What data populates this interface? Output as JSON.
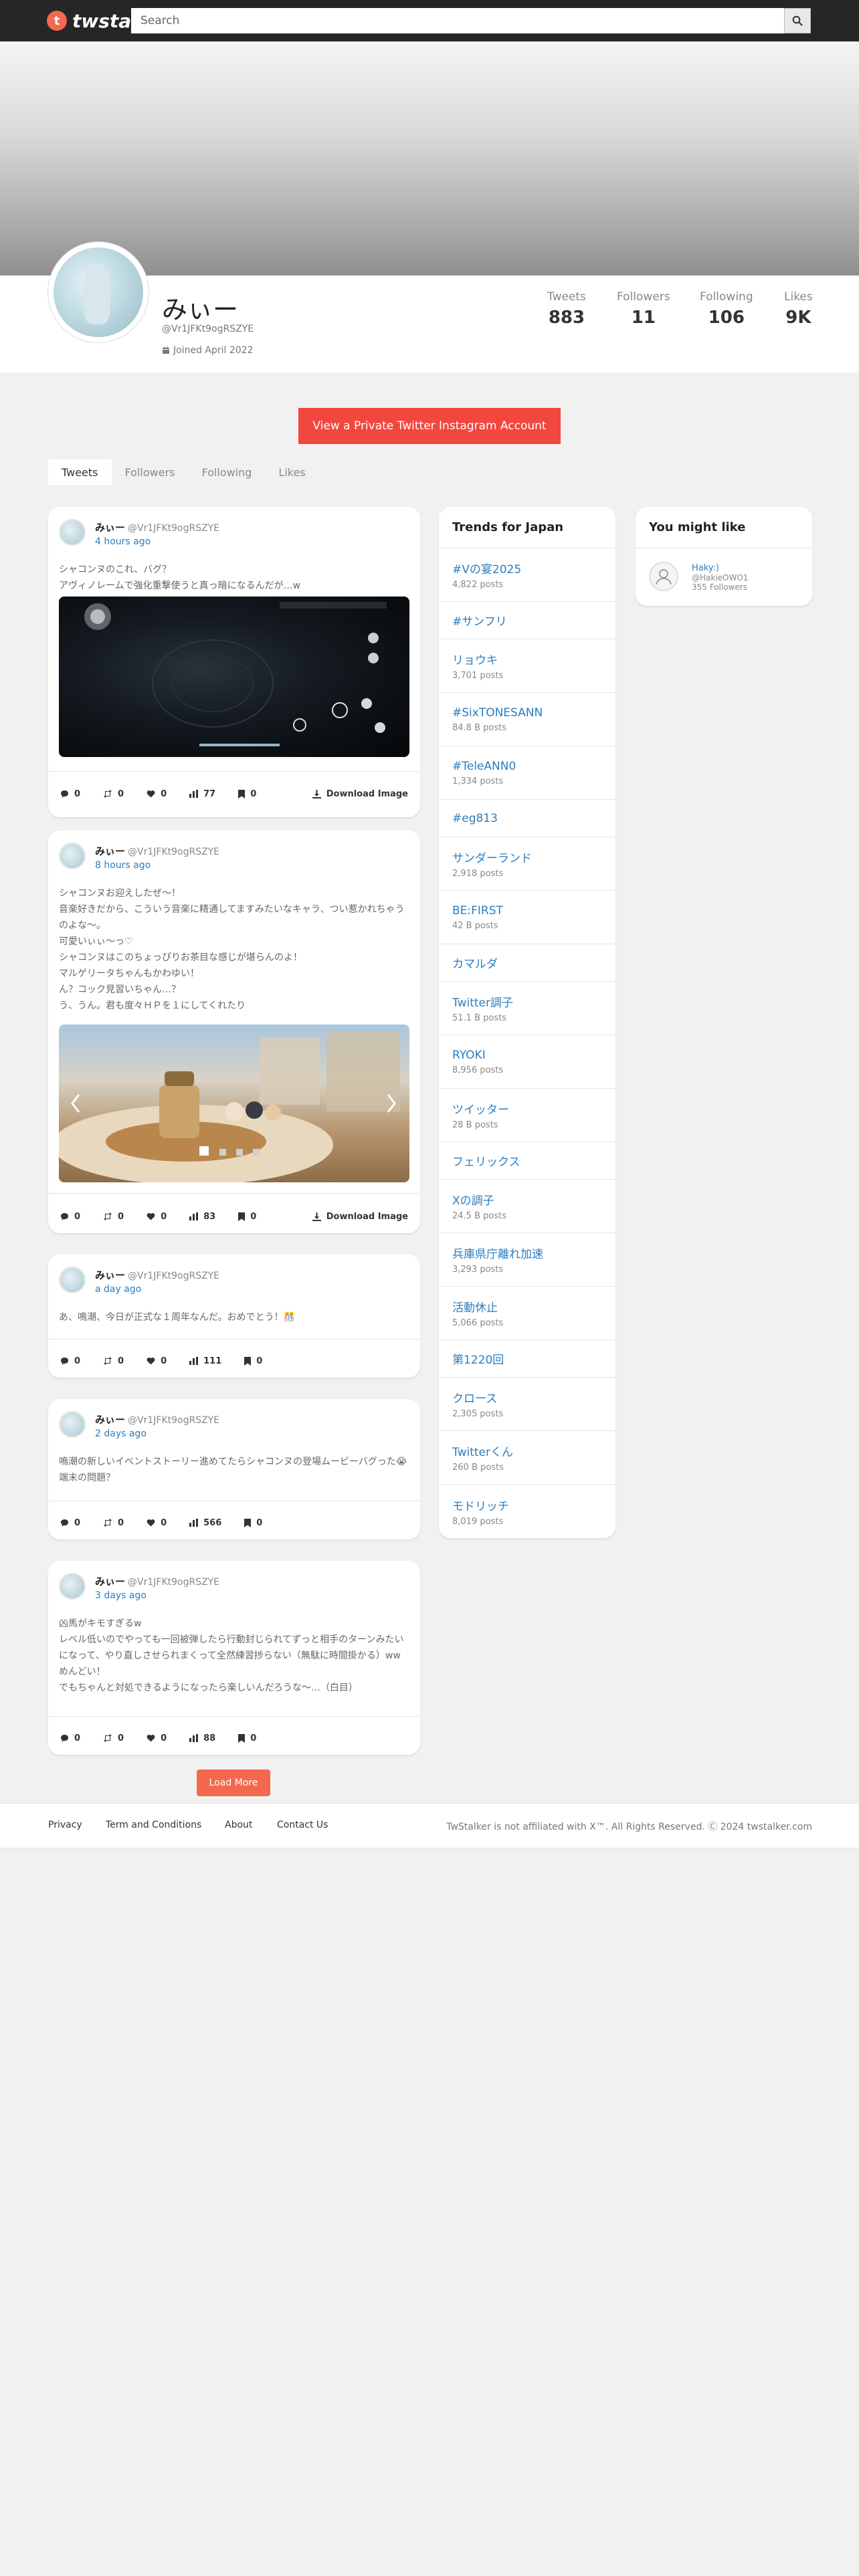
{
  "app": {
    "logo_text": "twstal",
    "logo_mark": "t"
  },
  "search": {
    "placeholder": "Search",
    "value": ""
  },
  "profile": {
    "display_name": "みぃー",
    "handle": "@Vr1JFKt9ogRSZYE",
    "joined": "Joined April 2022",
    "stats": [
      {
        "label": "Tweets",
        "value": "883"
      },
      {
        "label": "Followers",
        "value": "11"
      },
      {
        "label": "Following",
        "value": "106"
      },
      {
        "label": "Likes",
        "value": "9K"
      }
    ]
  },
  "cta_label": "View a Private Twitter Instagram Account",
  "tabs": [
    "Tweets",
    "Followers",
    "Following",
    "Likes"
  ],
  "tweets": [
    {
      "name": "みぃー",
      "handle": "@Vr1JFKt9ogRSZYE",
      "time": "4 hours ago",
      "text": "シャコンヌのこれ、バグ？\nアヴィノレームで強化重撃使うと真っ暗になるんだが…w",
      "counts": {
        "replies": "0",
        "retweets": "0",
        "likes": "0",
        "views": "77",
        "bookmarks": "0"
      },
      "download": "Download Image"
    },
    {
      "name": "みぃー",
      "handle": "@Vr1JFKt9ogRSZYE",
      "time": "8 hours ago",
      "text": "シャコンヌお迎えしたぜ〜！\n音楽好きだから、こういう音楽に精通してますみたいなキャラ、つい惹かれちゃうのよな〜。\n可愛いぃぃ〜っ♡\nシャコンヌはこのちょっぴりお茶目な感じが堪らんのよ！\nマルゲリータちゃんもかわゆい！\nん？コック見習いちゃん…？\nう、うん。君も度々ＨＰを１にしてくれたり",
      "counts": {
        "replies": "0",
        "retweets": "0",
        "likes": "0",
        "views": "83",
        "bookmarks": "0"
      },
      "download": "Download Image"
    },
    {
      "name": "みぃー",
      "handle": "@Vr1JFKt9ogRSZYE",
      "time": "a day ago",
      "text": "あ、鳴潮、今日が正式な１周年なんだ。おめでとう！🎊",
      "counts": {
        "replies": "0",
        "retweets": "0",
        "likes": "0",
        "views": "111",
        "bookmarks": "0"
      }
    },
    {
      "name": "みぃー",
      "handle": "@Vr1JFKt9ogRSZYE",
      "time": "2 days ago",
      "text": "鳴潮の新しいイベントストーリー進めてたらシャコンヌの登場ムービーバグった😭\n端末の問題？",
      "counts": {
        "replies": "0",
        "retweets": "0",
        "likes": "0",
        "views": "566",
        "bookmarks": "0"
      }
    },
    {
      "name": "みぃー",
      "handle": "@Vr1JFKt9ogRSZYE",
      "time": "3 days ago",
      "text": "凶馬がキモすぎるw\nレベル低いのでやっても一回被弾したら行動封じられてずっと相手のターンみたいになって、やり直しさせられまくって全然練習捗らない（無駄に時間掛かる）ww\nめんどい！\nでもちゃんと対処できるようになったら楽しいんだろうな〜…（白目）",
      "counts": {
        "replies": "0",
        "retweets": "0",
        "likes": "0",
        "views": "88",
        "bookmarks": "0"
      }
    }
  ],
  "trends": {
    "title": "Trends for Japan",
    "items": [
      {
        "name": "#Vの宴2025",
        "posts": "4,822 posts"
      },
      {
        "name": "#サンフリ",
        "posts": ""
      },
      {
        "name": "リョウキ",
        "posts": "3,701 posts"
      },
      {
        "name": "#SixTONESANN",
        "posts": "84.8 B posts"
      },
      {
        "name": "#TeleANN0",
        "posts": "1,334 posts"
      },
      {
        "name": "#eg813",
        "posts": ""
      },
      {
        "name": "サンダーランド",
        "posts": "2,918 posts"
      },
      {
        "name": "BE:FIRST",
        "posts": "42 B posts"
      },
      {
        "name": "カマルダ",
        "posts": ""
      },
      {
        "name": "Twitter調子",
        "posts": "51.1 B posts"
      },
      {
        "name": "RYOKI",
        "posts": "8,956 posts"
      },
      {
        "name": "ツイッター",
        "posts": "28 B posts"
      },
      {
        "name": "フェリックス",
        "posts": ""
      },
      {
        "name": "Xの調子",
        "posts": "24.5 B posts"
      },
      {
        "name": "兵庫県庁離れ加速",
        "posts": "3,293 posts"
      },
      {
        "name": "活動休止",
        "posts": "5,066 posts"
      },
      {
        "name": "第1220回",
        "posts": ""
      },
      {
        "name": "クロース",
        "posts": "2,305 posts"
      },
      {
        "name": "Twitterくん",
        "posts": "260 B posts"
      },
      {
        "name": "モドリッチ",
        "posts": "8,019 posts"
      }
    ]
  },
  "might_like": {
    "title": "You might like",
    "user": {
      "name": "Haky:)",
      "handle": "@HakieOWO1",
      "followers": "355 Followers"
    }
  },
  "load_more": "Load More",
  "footer": {
    "links": [
      "Privacy",
      "Term and Conditions",
      "About",
      "Contact Us"
    ],
    "copyright": "TwStalker is not affiliated with X™. All Rights Reserved. Ⓒ 2024 twstalker.com"
  }
}
